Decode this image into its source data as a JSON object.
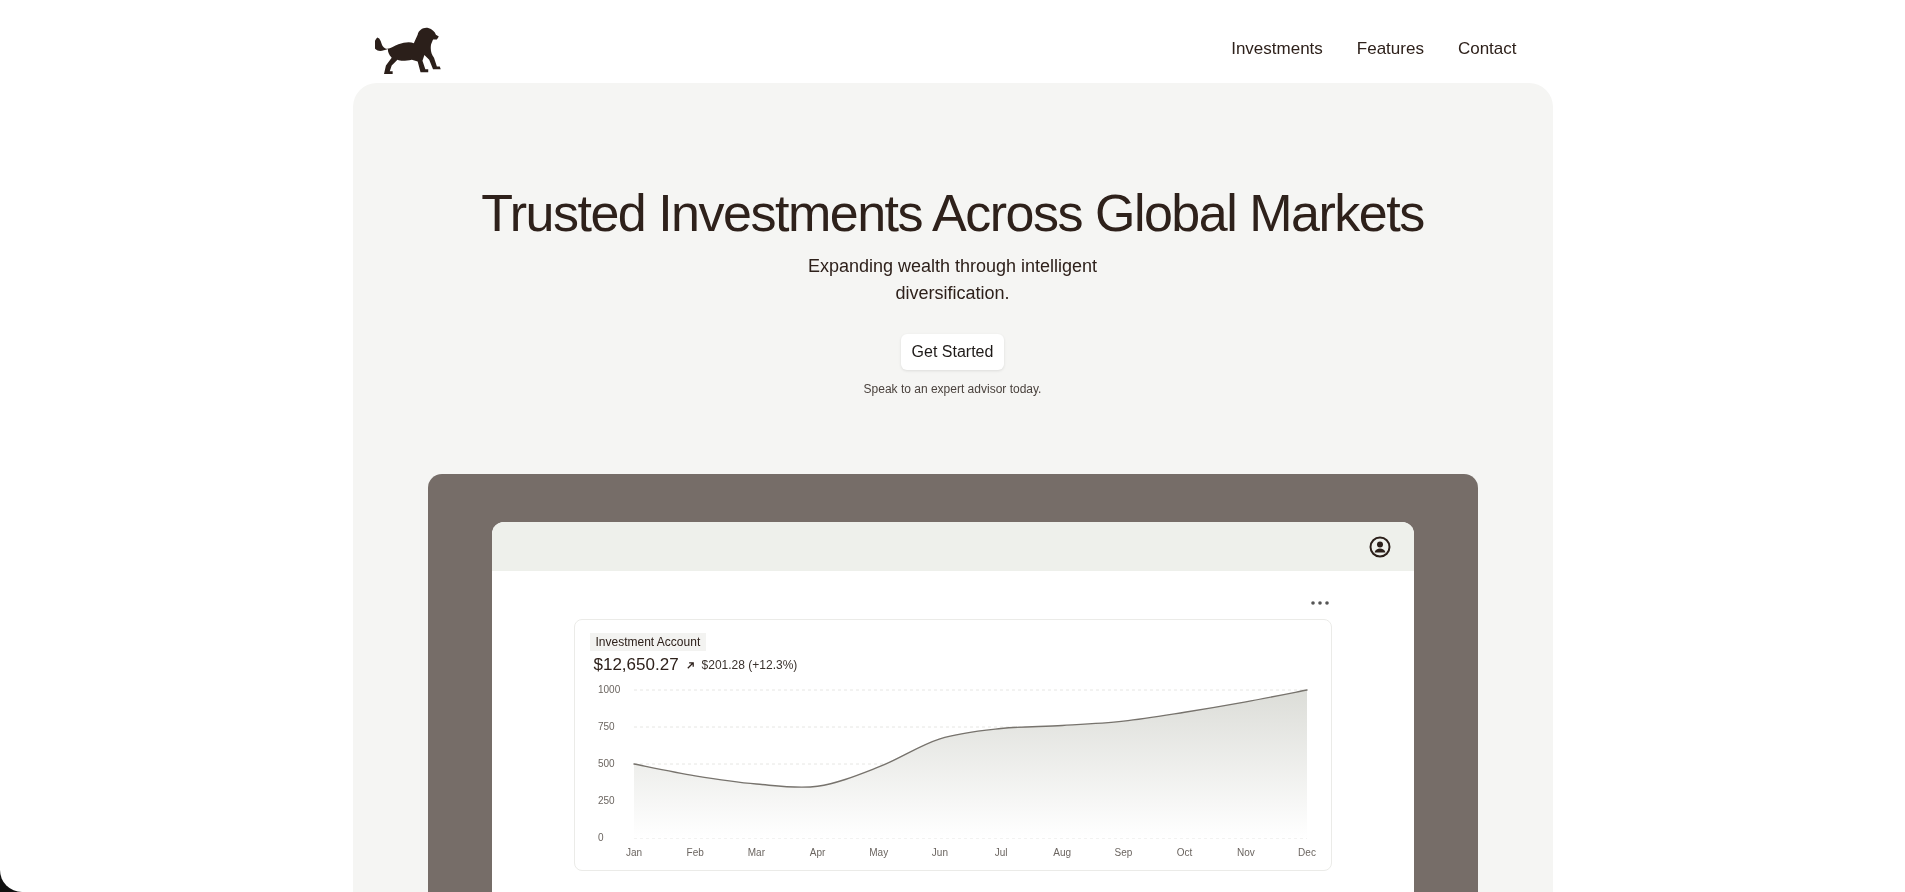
{
  "header": {
    "nav": [
      {
        "label": "Investments"
      },
      {
        "label": "Features"
      },
      {
        "label": "Contact"
      }
    ]
  },
  "hero": {
    "title": "Trusted Investments Across Global Markets",
    "subtitle": "Expanding wealth through intelligent diversification.",
    "button": "Get Started",
    "note": "Speak to an expert advisor today."
  },
  "dashboard": {
    "card": {
      "label": "Investment Account",
      "amount": "$12,650.27",
      "change": "$201.28 (+12.3%)",
      "chart_data": {
        "type": "area",
        "categories": [
          "Jan",
          "Feb",
          "Mar",
          "Apr",
          "May",
          "Jun",
          "Jul",
          "Aug",
          "Sep",
          "Oct",
          "Nov",
          "Dec"
        ],
        "ylim": [
          0,
          1000
        ],
        "yticks": [
          0,
          250,
          500,
          750,
          1000
        ],
        "series": [
          {
            "color": "#77736d",
            "values": [
              500,
              420,
              365,
              350,
              480,
              670,
              740,
              760,
              790,
              850,
              920,
              1000
            ]
          }
        ]
      }
    }
  }
}
